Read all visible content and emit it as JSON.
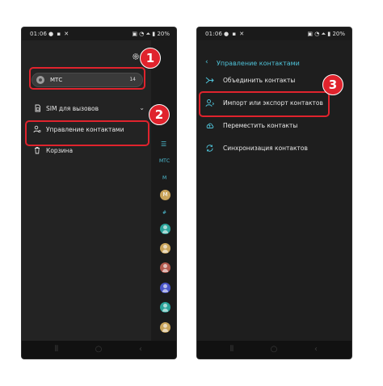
{
  "left_phone": {
    "status": {
      "time": "01:06",
      "battery": "20%"
    },
    "account": {
      "name": "МТС",
      "count": "14"
    },
    "menu": [
      {
        "label": "SIM для вызовов",
        "icon": "sim-card-icon",
        "chevron": "⌄"
      },
      {
        "label": "Управление контактами",
        "icon": "person-settings-icon"
      },
      {
        "label": "Корзина",
        "icon": "trash-icon"
      }
    ],
    "index_labels": [
      "МТС",
      "М",
      "#"
    ],
    "contact_letter": "M",
    "contact_dot_colors": [
      "#c9a45a",
      "#2aa39a",
      "#c9a45a",
      "#b35a4e",
      "#4a56c9",
      "#2aa39a",
      "#c9a45a"
    ]
  },
  "right_phone": {
    "status": {
      "time": "01:06",
      "battery": "20%"
    },
    "title": "Управление контактами",
    "items": [
      {
        "label": "Объединить контакты",
        "icon": "merge-icon"
      },
      {
        "label": "Импорт или экспорт контактов",
        "icon": "import-export-icon"
      },
      {
        "label": "Переместить контакты",
        "icon": "cloud-upload-icon"
      },
      {
        "label": "Синхронизация контактов",
        "icon": "sync-icon"
      }
    ]
  },
  "badges": [
    "1",
    "2",
    "3"
  ],
  "colors": {
    "accent": "#4fc3d9",
    "highlight": "#e0232d",
    "background": "#1a1a1a"
  }
}
